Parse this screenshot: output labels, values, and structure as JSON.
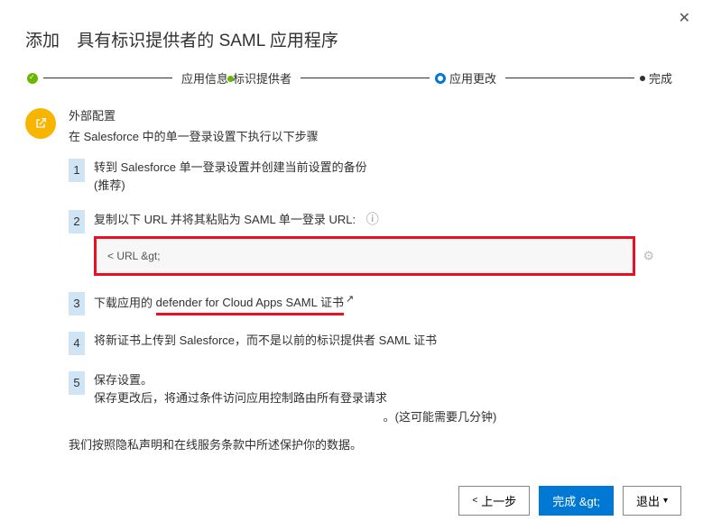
{
  "header": {
    "prefix": "添加",
    "title": "具有标识提供者的 SAML 应用程序"
  },
  "stepper": {
    "step1a": "应用信息",
    "step1b": "标识提供者",
    "step2": "应用更改",
    "step3": "完成"
  },
  "external": {
    "title": "外部配置",
    "subtitle": "在 Salesforce 中的单一登录设置下执行以下步骤"
  },
  "steps": {
    "s1": {
      "line1": "转到 Salesforce 单一登录设置并创建当前设置的备份",
      "line2": "(推荐)"
    },
    "s2": {
      "text": "复制以下 URL 并将其粘贴为 SAML 单一登录 URL:",
      "urlbox": "< URL &gt;"
    },
    "s3": {
      "pre": "下载应用的 ",
      "link": "defender for Cloud Apps SAML 证书"
    },
    "s4": {
      "text": "将新证书上传到 Salesforce，而不是以前的标识提供者 SAML 证书"
    },
    "s5": {
      "line1": "保存设置。",
      "line2": "保存更改后，将通过条件访问应用控制路由所有登录请求",
      "note": "。(这可能需要几分钟)"
    }
  },
  "privacy": "我们按照隐私声明和在线服务条款中所述保护你的数据。",
  "footer": {
    "prev": "上一步",
    "finish": "完成 &gt;",
    "exit": "退出"
  }
}
